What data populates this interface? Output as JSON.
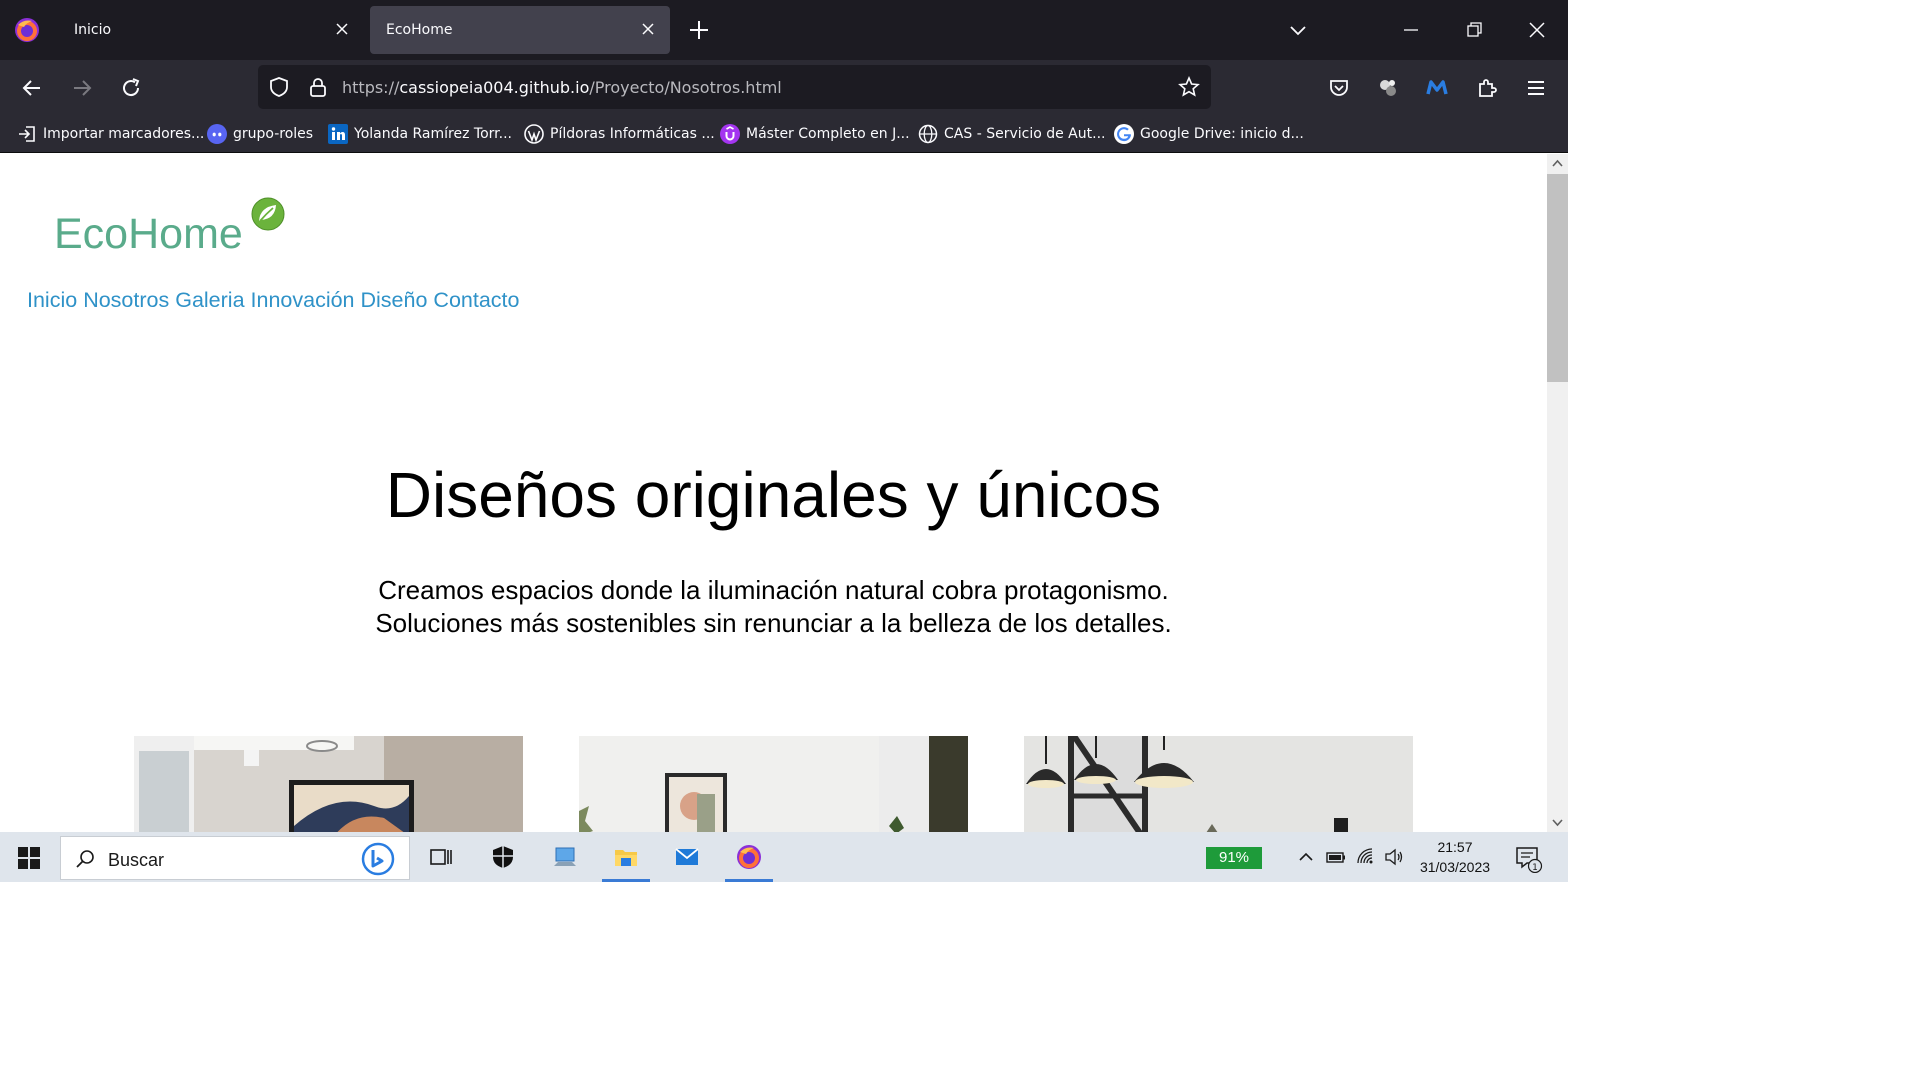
{
  "browser": {
    "tabs": [
      {
        "title": "Inicio",
        "active": false
      },
      {
        "title": "EcoHome",
        "active": true
      }
    ],
    "url": {
      "scheme": "https://",
      "host": "cassiopeia004.github.io",
      "path": "/Proyecto/Nosotros.html"
    },
    "bookmarks": [
      {
        "label": "Importar marcadores...",
        "icon": "import-icon"
      },
      {
        "label": "grupo-roles",
        "icon": "discord-icon"
      },
      {
        "label": "Yolanda Ramírez Torr...",
        "icon": "linkedin-icon"
      },
      {
        "label": "Píldoras Informáticas ...",
        "icon": "wordpress-icon"
      },
      {
        "label": "Máster Completo en J...",
        "icon": "udemy-icon"
      },
      {
        "label": "CAS - Servicio de Aut...",
        "icon": "globe-icon"
      },
      {
        "label": "Google Drive: inicio d...",
        "icon": "google-icon"
      }
    ]
  },
  "site": {
    "logo": "EcoHome",
    "nav": [
      "Inicio",
      "Nosotros",
      "Galeria",
      "Innovación",
      "Diseño",
      "Contacto"
    ],
    "hero_title": "Diseños originales y únicos",
    "hero_line1": "Creamos espacios donde la iluminación natural cobra protagonismo.",
    "hero_line2": "Soluciones más sostenibles sin renunciar a la belleza de los detalles.",
    "colors": {
      "logo": "#5aab8b",
      "nav": "#2f92c8"
    }
  },
  "taskbar": {
    "search_placeholder": "Buscar",
    "battery": "91%",
    "time": "21:57",
    "date": "31/03/2023",
    "notification_count": "1"
  }
}
